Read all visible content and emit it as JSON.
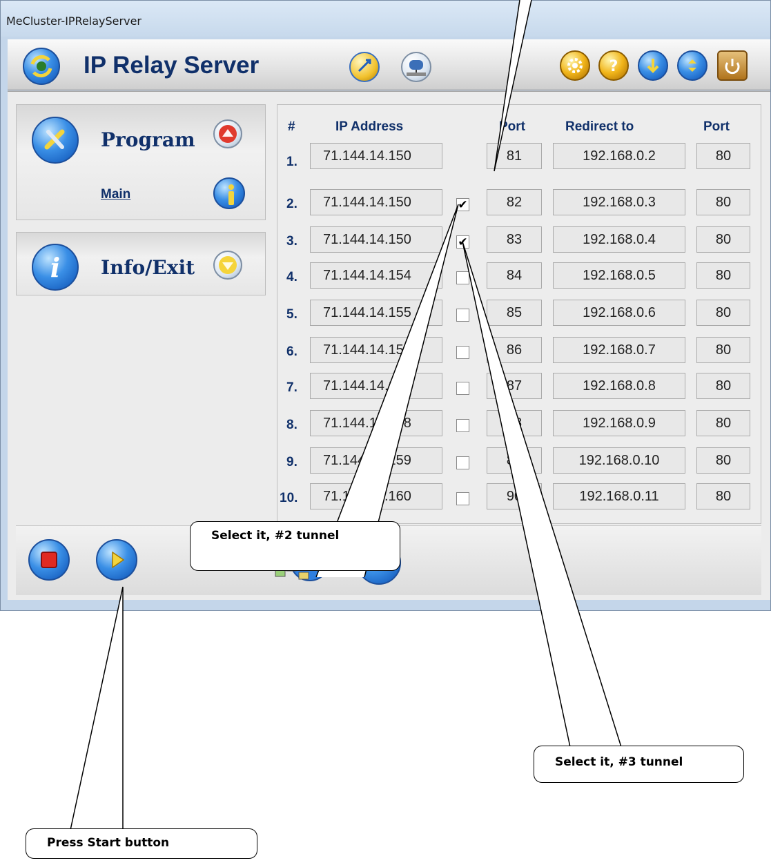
{
  "window": {
    "title": "MeCluster-IPRelayServer"
  },
  "header": {
    "app_title": "IP Relay Server"
  },
  "sidebar": {
    "program_label": "Program",
    "main_link": "Main",
    "info_label": "Info/Exit"
  },
  "table": {
    "headers": {
      "num": "#",
      "ip": "IP Address",
      "port": "Port",
      "redirect": "Redirect to",
      "dest_port": "Port"
    },
    "rows": [
      {
        "num": "1.",
        "ip": "71.144.14.150",
        "checked": null,
        "port": "81",
        "redirect": "192.168.0.2",
        "dest_port": "80"
      },
      {
        "num": "2.",
        "ip": "71.144.14.150",
        "checked": true,
        "port": "82",
        "redirect": "192.168.0.3",
        "dest_port": "80"
      },
      {
        "num": "3.",
        "ip": "71.144.14.150",
        "checked": true,
        "port": "83",
        "redirect": "192.168.0.4",
        "dest_port": "80"
      },
      {
        "num": "4.",
        "ip": "71.144.14.154",
        "checked": false,
        "port": "84",
        "redirect": "192.168.0.5",
        "dest_port": "80"
      },
      {
        "num": "5.",
        "ip": "71.144.14.155",
        "checked": false,
        "port": "85",
        "redirect": "192.168.0.6",
        "dest_port": "80"
      },
      {
        "num": "6.",
        "ip": "71.144.14.156",
        "checked": false,
        "port": "86",
        "redirect": "192.168.0.7",
        "dest_port": "80"
      },
      {
        "num": "7.",
        "ip": "71.144.14.157",
        "checked": false,
        "port": "87",
        "redirect": "192.168.0.8",
        "dest_port": "80"
      },
      {
        "num": "8.",
        "ip": "71.144.14.158",
        "checked": false,
        "port": "88",
        "redirect": "192.168.0.9",
        "dest_port": "80"
      },
      {
        "num": "9.",
        "ip": "71.144.14.159",
        "checked": false,
        "port": "89",
        "redirect": "192.168.0.10",
        "dest_port": "80"
      },
      {
        "num": "10.",
        "ip": "71.144.14.160",
        "checked": false,
        "port": "90",
        "redirect": "192.168.0.11",
        "dest_port": "80"
      }
    ]
  },
  "icons": {
    "app": "globe-refresh-icon",
    "header_left": [
      "network-search-icon",
      "network-drive-icon"
    ],
    "header_right": [
      "settings-icon",
      "help-icon",
      "download-icon",
      "upload-icon",
      "power-icon"
    ],
    "program": "tools-icon",
    "main": "info-user-icon",
    "info": "info-icon",
    "collapse": "arrow-up-icon",
    "expand": "arrow-down-icon",
    "stop": "stop-icon",
    "start": "play-icon",
    "network": "network-upload-icon"
  },
  "colors": {
    "heading": "#10306a",
    "accent_blue": "#1f6fd6",
    "gold": "#f1b51a",
    "red": "#e7443c"
  },
  "callouts": {
    "tunnel2": "Select it, #2 tunnel",
    "tunnel3": "Select it, #3 tunnel",
    "start": "Press Start button"
  }
}
